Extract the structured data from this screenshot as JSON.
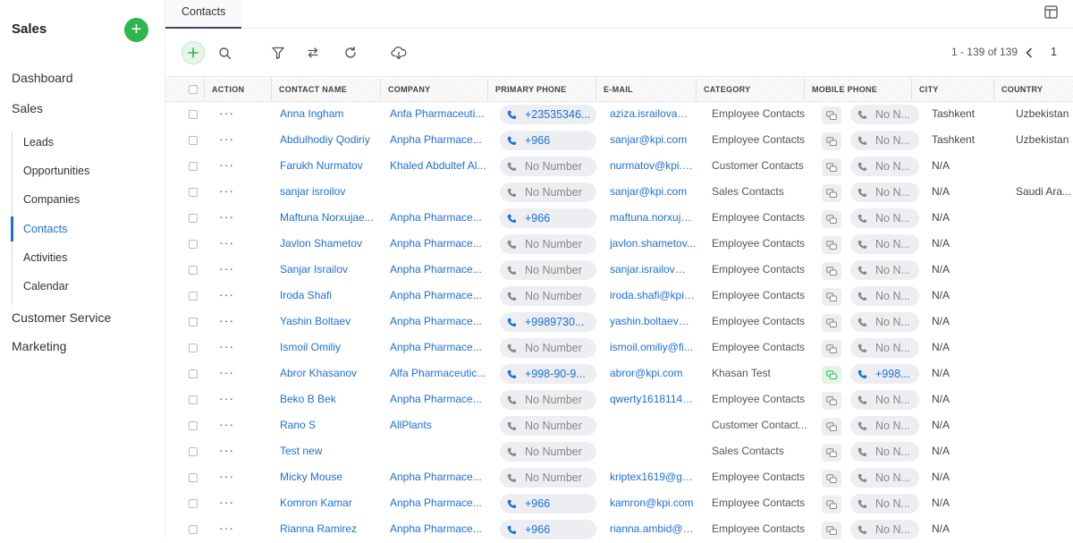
{
  "sidebar": {
    "title": "Sales",
    "top_items": [
      {
        "label": "Dashboard"
      },
      {
        "label": "Sales"
      }
    ],
    "sub_items": [
      {
        "label": "Leads"
      },
      {
        "label": "Opportunities"
      },
      {
        "label": "Companies"
      },
      {
        "label": "Contacts",
        "active": true
      },
      {
        "label": "Activities"
      },
      {
        "label": "Calendar"
      }
    ],
    "bottom_items": [
      {
        "label": "Customer Service"
      },
      {
        "label": "Marketing"
      }
    ]
  },
  "tabs": [
    {
      "label": "Contacts"
    }
  ],
  "pager": {
    "range": "1 - 139 of 139",
    "page": "1"
  },
  "columns": [
    "ACTION",
    "CONTACT NAME",
    "COMPANY",
    "PRIMARY PHONE",
    "E-MAIL",
    "CATEGORY",
    "MOBILE PHONE",
    "CITY",
    "COUNTRY"
  ],
  "rows": [
    {
      "name": "Anna Ingham",
      "company": "Anfa Pharmaceuti...",
      "phone": "+23535346...",
      "phone_set": true,
      "email": "aziza.israilova@fi...",
      "category": "Employee Contacts",
      "mobile": "No N...",
      "mobile_set": false,
      "city": "Tashkent",
      "country": "Uzbekistan"
    },
    {
      "name": "Abdulhodiy Qodiriy",
      "company": "Anpha Pharmace...",
      "phone": "+966",
      "phone_set": true,
      "email": "sanjar@kpi.com",
      "category": "Employee Contacts",
      "mobile": "No N...",
      "mobile_set": false,
      "city": "Tashkent",
      "country": "Uzbekistan"
    },
    {
      "name": "Farukh Nurmatov",
      "company": "Khaled Abdultef Al...",
      "phone": "No Number",
      "phone_set": false,
      "email": "nurmatov@kpi.com",
      "category": "Customer Contacts",
      "mobile": "No N...",
      "mobile_set": false,
      "city": "N/A",
      "country": ""
    },
    {
      "name": "sanjar isroilov",
      "company": "",
      "phone": "No Number",
      "phone_set": false,
      "email": "sanjar@kpi.com",
      "category": "Sales Contacts",
      "mobile": "No N...",
      "mobile_set": false,
      "city": "N/A",
      "country": "Saudi Ara..."
    },
    {
      "name": "Maftuna Norxujae...",
      "company": "Anpha Pharmace...",
      "phone": "+966",
      "phone_set": true,
      "email": "maftuna.norxuja...",
      "category": "Employee Contacts",
      "mobile": "No N...",
      "mobile_set": false,
      "city": "N/A",
      "country": ""
    },
    {
      "name": "Javlon Shametov",
      "company": "Anpha Pharmace...",
      "phone": "No Number",
      "phone_set": false,
      "email": "javlon.shametov...",
      "category": "Employee Contacts",
      "mobile": "No N...",
      "mobile_set": false,
      "city": "N/A",
      "country": ""
    },
    {
      "name": "Sanjar Israilov",
      "company": "Anpha Pharmace...",
      "phone": "No Number",
      "phone_set": false,
      "email": "sanjar.israilov@fi...",
      "category": "Employee Contacts",
      "mobile": "No N...",
      "mobile_set": false,
      "city": "N/A",
      "country": ""
    },
    {
      "name": "Iroda Shafi",
      "company": "Anpha Pharmace...",
      "phone": "No Number",
      "phone_set": false,
      "email": "iroda.shafi@kpi.c...",
      "category": "Employee Contacts",
      "mobile": "No N...",
      "mobile_set": false,
      "city": "N/A",
      "country": ""
    },
    {
      "name": "Yashin Boltaev",
      "company": "Anpha Pharmace...",
      "phone": "+9989730...",
      "phone_set": true,
      "email": "yashin.boltaev@...",
      "category": "Employee Contacts",
      "mobile": "No N...",
      "mobile_set": false,
      "city": "N/A",
      "country": ""
    },
    {
      "name": "Ismoil Omiliy",
      "company": "Anpha Pharmace...",
      "phone": "No Number",
      "phone_set": false,
      "email": "ismoil.omiliy@fi...",
      "category": "Employee Contacts",
      "mobile": "No N...",
      "mobile_set": false,
      "city": "N/A",
      "country": ""
    },
    {
      "name": "Abror Khasanov",
      "company": "Alfa Pharmaceutic...",
      "phone": "+998-90-9...",
      "phone_set": true,
      "email": "abror@kpi.com",
      "category": "Khasan Test",
      "mobile": "+998...",
      "mobile_set": true,
      "city": "N/A",
      "country": ""
    },
    {
      "name": "Beko B Bek",
      "company": "Anpha Pharmace...",
      "phone": "No Number",
      "phone_set": false,
      "email": "qwerty1618114@...",
      "category": "Employee Contacts",
      "mobile": "No N...",
      "mobile_set": false,
      "city": "N/A",
      "country": ""
    },
    {
      "name": "Rano S",
      "company": "AllPlants",
      "phone": "No Number",
      "phone_set": false,
      "email": "",
      "category": "Customer Contact...",
      "mobile": "No N...",
      "mobile_set": false,
      "city": "N/A",
      "country": ""
    },
    {
      "name": "Test new",
      "company": "",
      "phone": "No Number",
      "phone_set": false,
      "email": "",
      "category": "Sales Contacts",
      "mobile": "No N...",
      "mobile_set": false,
      "city": "N/A",
      "country": ""
    },
    {
      "name": "Micky Mouse",
      "company": "Anpha Pharmace...",
      "phone": "No Number",
      "phone_set": false,
      "email": "kriptex1619@gm...",
      "category": "Employee Contacts",
      "mobile": "No N...",
      "mobile_set": false,
      "city": "N/A",
      "country": ""
    },
    {
      "name": "Komron Kamar",
      "company": "Anpha Pharmace...",
      "phone": "+966",
      "phone_set": true,
      "email": "kamron@kpi.com",
      "category": "Employee Contacts",
      "mobile": "No N...",
      "mobile_set": false,
      "city": "N/A",
      "country": ""
    },
    {
      "name": "Rianna Ramirez",
      "company": "Anpha Pharmace...",
      "phone": "+966",
      "phone_set": true,
      "email": "rianna.ambid@g...",
      "category": "Employee Contacts",
      "mobile": "No N...",
      "mobile_set": false,
      "city": "N/A",
      "country": ""
    }
  ],
  "row_action_label": "···",
  "colors": {
    "accent": "#1e6fd9",
    "add_green": "#2db84d",
    "pill_bg": "#eceef1"
  }
}
